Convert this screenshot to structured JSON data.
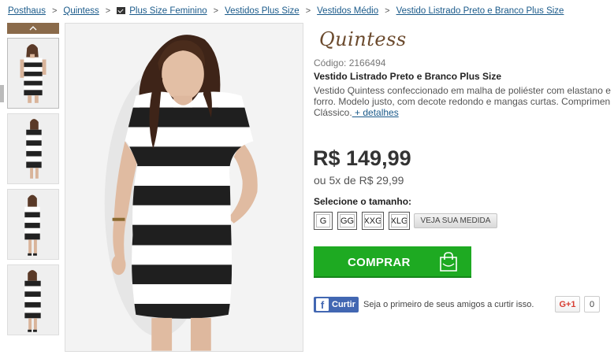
{
  "breadcrumb": {
    "items": [
      "Posthaus",
      "Quintess",
      "Plus Size Feminino",
      "Vestidos Plus Size",
      "Vestidos Médio",
      "Vestido Listrado Preto e Branco Plus Size"
    ],
    "separator": ">"
  },
  "gallery": {
    "thumbnail_count": 4,
    "scroll_up_icon": "chevron-up-icon"
  },
  "product": {
    "brand": "Quintess",
    "code": "Código: 2166494",
    "title": "Vestido Listrado Preto e Branco Plus Size",
    "description_line1": "Vestido Quintess confeccionado em malha de poliéster com elastano e",
    "description_line2": "forro. Modelo justo, com decote redondo e mangas curtas. Comprimen",
    "description_line3": "Clássico.",
    "details_link": " + detalhes",
    "price": "R$ 149,99",
    "installments": "ou 5x de R$ 29,99"
  },
  "sizes": {
    "label": "Selecione o tamanho:",
    "options": [
      "G",
      "GG",
      "XXG",
      "XLG"
    ],
    "measure_button": "VEJA SUA MEDIDA"
  },
  "buy": {
    "label": "COMPRAR",
    "icon": "shopping-bag-icon"
  },
  "social": {
    "facebook_label": "Curtir",
    "facebook_text": "Seja o primeiro de seus amigos a curtir isso.",
    "gplus_label": "G+1",
    "gplus_count": "0"
  },
  "colors": {
    "brand": "#6b4a2d",
    "link": "#1a5a8a",
    "buy_green": "#1eaa22",
    "facebook": "#4267b2"
  }
}
